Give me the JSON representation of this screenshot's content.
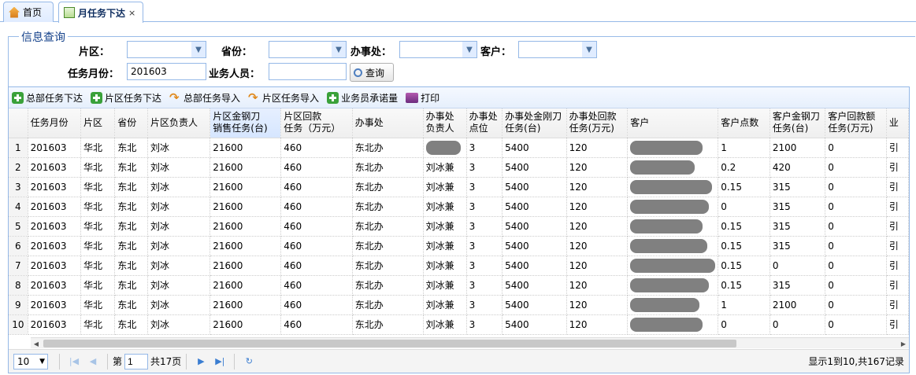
{
  "tabs": [
    {
      "label": "首页"
    },
    {
      "label": "月任务下达",
      "close": "×"
    }
  ],
  "query": {
    "legend": "信息查询",
    "area_label": "片区：",
    "province_label": "省份：",
    "office_label": "办事处：",
    "customer_label": "客户：",
    "month_label": "任务月份：",
    "month_value": "201603",
    "salesperson_label": "业务人员：",
    "salesperson_value": "",
    "search_button": "查询"
  },
  "toolbar": {
    "buttons": [
      "总部任务下达",
      "片区任务下达",
      "总部任务导入",
      "片区任务导入",
      "业务员承诺量",
      "打印"
    ]
  },
  "grid": {
    "columns": [
      "任务月份",
      "片区",
      "省份",
      "片区负责人",
      "片区金钢刀销售任务(台)",
      "片区回款任务（万元）",
      "办事处",
      "办事处负责人",
      "办事处点位",
      "办事处金刚刀任务(台)",
      "办事处回款任务(万元)",
      "客户",
      "客户点数",
      "客户金钢刀任务(台)",
      "客户回款额任务(万元)",
      "业"
    ],
    "rows": [
      {
        "n": "1",
        "month": "201603",
        "area": "华北",
        "prov": "东北",
        "area_mgr": "刘冰",
        "area_knife": "21600",
        "area_pay": "460",
        "office": "东北办",
        "office_mgr": "",
        "pts": "3",
        "off_knife": "5400",
        "off_pay": "120",
        "cust_pts": "1",
        "cust_knife": "2100",
        "cust_pay": "0",
        "biz": "引"
      },
      {
        "n": "2",
        "month": "201603",
        "area": "华北",
        "prov": "东北",
        "area_mgr": "刘冰",
        "area_knife": "21600",
        "area_pay": "460",
        "office": "东北办",
        "office_mgr": "刘冰兼",
        "pts": "3",
        "off_knife": "5400",
        "off_pay": "120",
        "cust_pts": "0.2",
        "cust_knife": "420",
        "cust_pay": "0",
        "biz": "引"
      },
      {
        "n": "3",
        "month": "201603",
        "area": "华北",
        "prov": "东北",
        "area_mgr": "刘冰",
        "area_knife": "21600",
        "area_pay": "460",
        "office": "东北办",
        "office_mgr": "刘冰兼",
        "pts": "3",
        "off_knife": "5400",
        "off_pay": "120",
        "cust_pts": "0.15",
        "cust_knife": "315",
        "cust_pay": "0",
        "biz": "引"
      },
      {
        "n": "4",
        "month": "201603",
        "area": "华北",
        "prov": "东北",
        "area_mgr": "刘冰",
        "area_knife": "21600",
        "area_pay": "460",
        "office": "东北办",
        "office_mgr": "刘冰兼",
        "pts": "3",
        "off_knife": "5400",
        "off_pay": "120",
        "cust_pts": "0",
        "cust_knife": "315",
        "cust_pay": "0",
        "biz": "引"
      },
      {
        "n": "5",
        "month": "201603",
        "area": "华北",
        "prov": "东北",
        "area_mgr": "刘冰",
        "area_knife": "21600",
        "area_pay": "460",
        "office": "东北办",
        "office_mgr": "刘冰兼",
        "pts": "3",
        "off_knife": "5400",
        "off_pay": "120",
        "cust_pts": "0.15",
        "cust_knife": "315",
        "cust_pay": "0",
        "biz": "引"
      },
      {
        "n": "6",
        "month": "201603",
        "area": "华北",
        "prov": "东北",
        "area_mgr": "刘冰",
        "area_knife": "21600",
        "area_pay": "460",
        "office": "东北办",
        "office_mgr": "刘冰兼",
        "pts": "3",
        "off_knife": "5400",
        "off_pay": "120",
        "cust_pts": "0.15",
        "cust_knife": "315",
        "cust_pay": "0",
        "biz": "引"
      },
      {
        "n": "7",
        "month": "201603",
        "area": "华北",
        "prov": "东北",
        "area_mgr": "刘冰",
        "area_knife": "21600",
        "area_pay": "460",
        "office": "东北办",
        "office_mgr": "刘冰兼",
        "pts": "3",
        "off_knife": "5400",
        "off_pay": "120",
        "cust_pts": "0.15",
        "cust_knife": "0",
        "cust_pay": "0",
        "biz": "引"
      },
      {
        "n": "8",
        "month": "201603",
        "area": "华北",
        "prov": "东北",
        "area_mgr": "刘冰",
        "area_knife": "21600",
        "area_pay": "460",
        "office": "东北办",
        "office_mgr": "刘冰兼",
        "pts": "3",
        "off_knife": "5400",
        "off_pay": "120",
        "cust_pts": "0.15",
        "cust_knife": "315",
        "cust_pay": "0",
        "biz": "引"
      },
      {
        "n": "9",
        "month": "201603",
        "area": "华北",
        "prov": "东北",
        "area_mgr": "刘冰",
        "area_knife": "21600",
        "area_pay": "460",
        "office": "东北办",
        "office_mgr": "刘冰兼",
        "pts": "3",
        "off_knife": "5400",
        "off_pay": "120",
        "cust_pts": "1",
        "cust_knife": "2100",
        "cust_pay": "0",
        "biz": "引"
      },
      {
        "n": "10",
        "month": "201603",
        "area": "华北",
        "prov": "东北",
        "area_mgr": "刘冰",
        "area_knife": "21600",
        "area_pay": "460",
        "office": "东北办",
        "office_mgr": "刘冰兼",
        "pts": "3",
        "off_knife": "5400",
        "off_pay": "120",
        "cust_pts": "0",
        "cust_knife": "0",
        "cust_pay": "0",
        "biz": "引"
      }
    ]
  },
  "pager": {
    "page_size": "10",
    "page_prefix": "第",
    "page_number": "1",
    "page_total": "共17页",
    "info": "显示1到10,共167记录"
  }
}
